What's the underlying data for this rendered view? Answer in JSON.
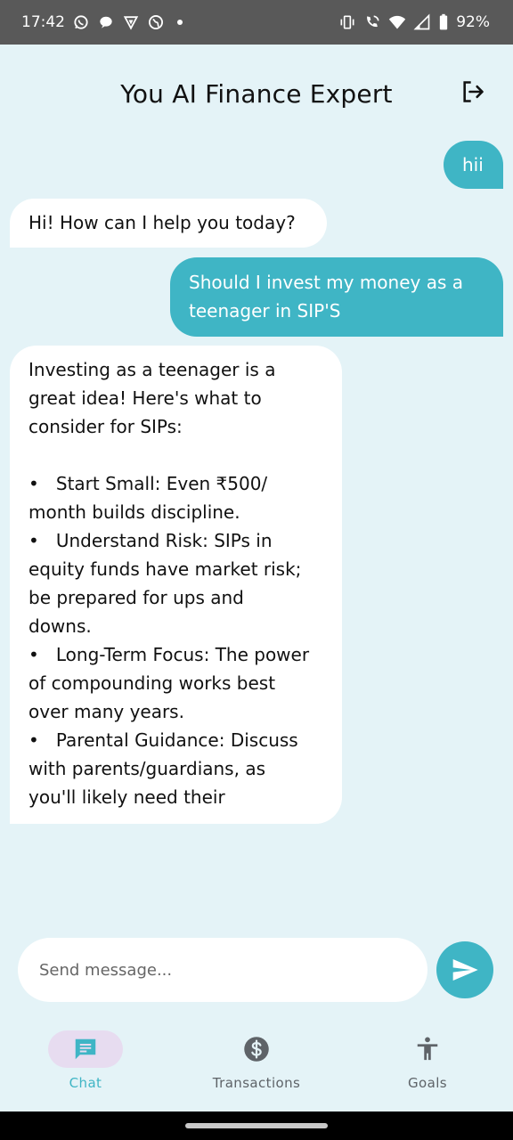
{
  "status_bar": {
    "time": "17:42",
    "battery": "92%",
    "left_icons": [
      "whatsapp-icon",
      "message-bubble-icon",
      "vpn-icon",
      "globe-icon"
    ],
    "right_icons": [
      "vibrate-icon",
      "wifi-call-icon",
      "wifi-icon",
      "signal-icon",
      "battery-icon"
    ]
  },
  "header": {
    "title": "You AI Finance Expert",
    "logout_icon": "logout-icon"
  },
  "messages": [
    {
      "role": "user",
      "text": "hii"
    },
    {
      "role": "assistant",
      "text": "Hi! How can I help you today?"
    },
    {
      "role": "user",
      "text": "Should I invest my money as a teenager in SIP'S"
    },
    {
      "role": "assistant",
      "lines": [
        "Investing as a teenager is a",
        "great idea! Here's what to",
        "consider for SIPs:",
        "",
        "•   Start Small: Even ₹500/",
        "month builds discipline.",
        "•   Understand Risk: SIPs in",
        "equity funds have market risk;",
        "be prepared for ups and",
        "downs.",
        "•   Long-Term Focus: The power",
        "of compounding works best",
        "over many years.",
        "•   Parental Guidance: Discuss",
        "with parents/guardians, as",
        "you'll likely need their"
      ]
    }
  ],
  "composer": {
    "placeholder": "Send message...",
    "value": "",
    "send_icon": "send-icon"
  },
  "bottom_nav": {
    "items": [
      {
        "label": "Chat",
        "icon": "chat-icon",
        "active": true
      },
      {
        "label": "Transactions",
        "icon": "dollar-icon",
        "active": false
      },
      {
        "label": "Goals",
        "icon": "person-icon",
        "active": false
      }
    ]
  },
  "colors": {
    "accent": "#3fb5c5",
    "background": "#e4f3f7",
    "bot_bubble": "#ffffff",
    "active_nav_pill": "#e7dcf0",
    "status_bar": "#595959"
  }
}
